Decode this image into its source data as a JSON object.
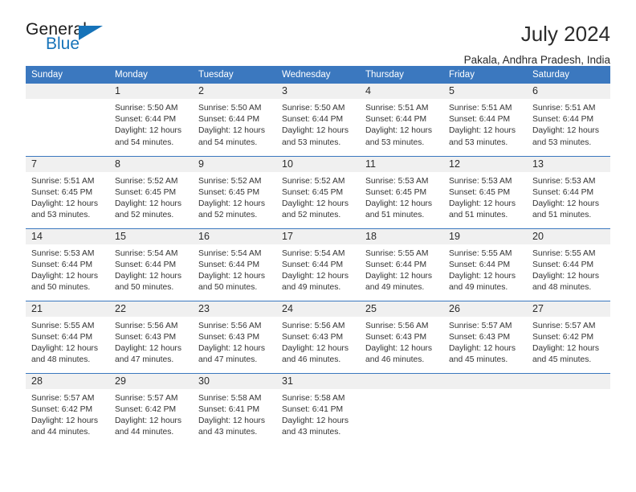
{
  "logo": {
    "word1": "General",
    "word2": "Blue",
    "triangle_color": "#1673b9"
  },
  "header": {
    "title": "July 2024",
    "subtitle": "Pakala, Andhra Pradesh, India"
  },
  "theme": {
    "header_blue": "#3b78bf",
    "daynum_band": "#f0f0f0",
    "text": "#333333"
  },
  "calendar": {
    "weekday_headers": [
      "Sunday",
      "Monday",
      "Tuesday",
      "Wednesday",
      "Thursday",
      "Friday",
      "Saturday"
    ],
    "weeks": [
      [
        {
          "day": "",
          "lines": []
        },
        {
          "day": "1",
          "lines": [
            "Sunrise: 5:50 AM",
            "Sunset: 6:44 PM",
            "Daylight: 12 hours",
            "and 54 minutes."
          ]
        },
        {
          "day": "2",
          "lines": [
            "Sunrise: 5:50 AM",
            "Sunset: 6:44 PM",
            "Daylight: 12 hours",
            "and 54 minutes."
          ]
        },
        {
          "day": "3",
          "lines": [
            "Sunrise: 5:50 AM",
            "Sunset: 6:44 PM",
            "Daylight: 12 hours",
            "and 53 minutes."
          ]
        },
        {
          "day": "4",
          "lines": [
            "Sunrise: 5:51 AM",
            "Sunset: 6:44 PM",
            "Daylight: 12 hours",
            "and 53 minutes."
          ]
        },
        {
          "day": "5",
          "lines": [
            "Sunrise: 5:51 AM",
            "Sunset: 6:44 PM",
            "Daylight: 12 hours",
            "and 53 minutes."
          ]
        },
        {
          "day": "6",
          "lines": [
            "Sunrise: 5:51 AM",
            "Sunset: 6:44 PM",
            "Daylight: 12 hours",
            "and 53 minutes."
          ]
        }
      ],
      [
        {
          "day": "7",
          "lines": [
            "Sunrise: 5:51 AM",
            "Sunset: 6:45 PM",
            "Daylight: 12 hours",
            "and 53 minutes."
          ]
        },
        {
          "day": "8",
          "lines": [
            "Sunrise: 5:52 AM",
            "Sunset: 6:45 PM",
            "Daylight: 12 hours",
            "and 52 minutes."
          ]
        },
        {
          "day": "9",
          "lines": [
            "Sunrise: 5:52 AM",
            "Sunset: 6:45 PM",
            "Daylight: 12 hours",
            "and 52 minutes."
          ]
        },
        {
          "day": "10",
          "lines": [
            "Sunrise: 5:52 AM",
            "Sunset: 6:45 PM",
            "Daylight: 12 hours",
            "and 52 minutes."
          ]
        },
        {
          "day": "11",
          "lines": [
            "Sunrise: 5:53 AM",
            "Sunset: 6:45 PM",
            "Daylight: 12 hours",
            "and 51 minutes."
          ]
        },
        {
          "day": "12",
          "lines": [
            "Sunrise: 5:53 AM",
            "Sunset: 6:45 PM",
            "Daylight: 12 hours",
            "and 51 minutes."
          ]
        },
        {
          "day": "13",
          "lines": [
            "Sunrise: 5:53 AM",
            "Sunset: 6:44 PM",
            "Daylight: 12 hours",
            "and 51 minutes."
          ]
        }
      ],
      [
        {
          "day": "14",
          "lines": [
            "Sunrise: 5:53 AM",
            "Sunset: 6:44 PM",
            "Daylight: 12 hours",
            "and 50 minutes."
          ]
        },
        {
          "day": "15",
          "lines": [
            "Sunrise: 5:54 AM",
            "Sunset: 6:44 PM",
            "Daylight: 12 hours",
            "and 50 minutes."
          ]
        },
        {
          "day": "16",
          "lines": [
            "Sunrise: 5:54 AM",
            "Sunset: 6:44 PM",
            "Daylight: 12 hours",
            "and 50 minutes."
          ]
        },
        {
          "day": "17",
          "lines": [
            "Sunrise: 5:54 AM",
            "Sunset: 6:44 PM",
            "Daylight: 12 hours",
            "and 49 minutes."
          ]
        },
        {
          "day": "18",
          "lines": [
            "Sunrise: 5:55 AM",
            "Sunset: 6:44 PM",
            "Daylight: 12 hours",
            "and 49 minutes."
          ]
        },
        {
          "day": "19",
          "lines": [
            "Sunrise: 5:55 AM",
            "Sunset: 6:44 PM",
            "Daylight: 12 hours",
            "and 49 minutes."
          ]
        },
        {
          "day": "20",
          "lines": [
            "Sunrise: 5:55 AM",
            "Sunset: 6:44 PM",
            "Daylight: 12 hours",
            "and 48 minutes."
          ]
        }
      ],
      [
        {
          "day": "21",
          "lines": [
            "Sunrise: 5:55 AM",
            "Sunset: 6:44 PM",
            "Daylight: 12 hours",
            "and 48 minutes."
          ]
        },
        {
          "day": "22",
          "lines": [
            "Sunrise: 5:56 AM",
            "Sunset: 6:43 PM",
            "Daylight: 12 hours",
            "and 47 minutes."
          ]
        },
        {
          "day": "23",
          "lines": [
            "Sunrise: 5:56 AM",
            "Sunset: 6:43 PM",
            "Daylight: 12 hours",
            "and 47 minutes."
          ]
        },
        {
          "day": "24",
          "lines": [
            "Sunrise: 5:56 AM",
            "Sunset: 6:43 PM",
            "Daylight: 12 hours",
            "and 46 minutes."
          ]
        },
        {
          "day": "25",
          "lines": [
            "Sunrise: 5:56 AM",
            "Sunset: 6:43 PM",
            "Daylight: 12 hours",
            "and 46 minutes."
          ]
        },
        {
          "day": "26",
          "lines": [
            "Sunrise: 5:57 AM",
            "Sunset: 6:43 PM",
            "Daylight: 12 hours",
            "and 45 minutes."
          ]
        },
        {
          "day": "27",
          "lines": [
            "Sunrise: 5:57 AM",
            "Sunset: 6:42 PM",
            "Daylight: 12 hours",
            "and 45 minutes."
          ]
        }
      ],
      [
        {
          "day": "28",
          "lines": [
            "Sunrise: 5:57 AM",
            "Sunset: 6:42 PM",
            "Daylight: 12 hours",
            "and 44 minutes."
          ]
        },
        {
          "day": "29",
          "lines": [
            "Sunrise: 5:57 AM",
            "Sunset: 6:42 PM",
            "Daylight: 12 hours",
            "and 44 minutes."
          ]
        },
        {
          "day": "30",
          "lines": [
            "Sunrise: 5:58 AM",
            "Sunset: 6:41 PM",
            "Daylight: 12 hours",
            "and 43 minutes."
          ]
        },
        {
          "day": "31",
          "lines": [
            "Sunrise: 5:58 AM",
            "Sunset: 6:41 PM",
            "Daylight: 12 hours",
            "and 43 minutes."
          ]
        },
        {
          "day": "",
          "lines": []
        },
        {
          "day": "",
          "lines": []
        },
        {
          "day": "",
          "lines": []
        }
      ]
    ]
  }
}
